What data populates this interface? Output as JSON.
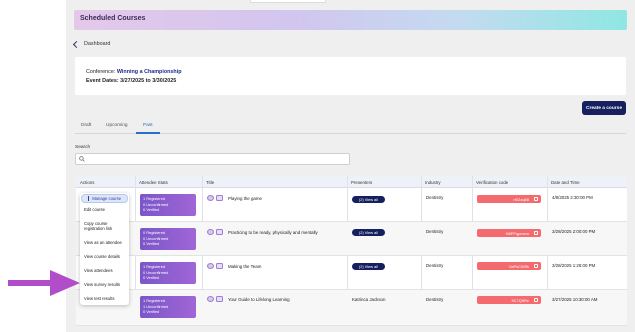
{
  "header": {
    "title": "Scheduled Courses"
  },
  "nav": {
    "back_label": "Dashboard"
  },
  "conference": {
    "conf_prefix": "Conference:",
    "conf_name": "Winning a Championship",
    "dates_label": "Event Dates: 3/27/2025 to 3/30/2025"
  },
  "actions": {
    "create_label": "Create a course"
  },
  "tabs": [
    {
      "label": "Draft"
    },
    {
      "label": "Upcoming"
    },
    {
      "label": "Past"
    }
  ],
  "active_tab": "Past",
  "search": {
    "label": "Search",
    "placeholder": ""
  },
  "table": {
    "columns": [
      "Actions",
      "Attendee Stats",
      "Title",
      "Presenters",
      "Industry",
      "Verification code",
      "Date and Time"
    ],
    "rows": [
      {
        "stats": [
          "1 Registered",
          "0 Unconfirmed",
          "0 Verified"
        ],
        "title": "Playing the game",
        "presenters": "(2) View all",
        "industry": "Dentistry",
        "code": "rt02zq88",
        "date": "4/8/2025 2:30:00 PM"
      },
      {
        "stats": [
          "0 Registered",
          "0 Unconfirmed",
          "0 Verified"
        ],
        "title": "Practicing to be ready, physically and mentally",
        "presenters": "(2) View all",
        "industry": "Dentistry",
        "code": "H8PFqpmcm",
        "date": "3/28/2025 2:00:00 PM"
      },
      {
        "stats": [
          "1 Registered",
          "0 Unconfirmed",
          "0 Verified"
        ],
        "title": "Making the Team",
        "presenters": "(2) View all",
        "industry": "Dentistry",
        "code": "VaPsCW9k",
        "date": "3/28/2025 1:25:00 PM"
      },
      {
        "stats": [
          "1 Registered",
          "1 Unconfirmed",
          "0 Verified"
        ],
        "title": "Your Guide to Lifelong Learning",
        "presenters": "Katrinca Jackson",
        "industry": "Dentistry",
        "code": "9C7Q9Rc",
        "date": "3/27/2025 10:30:00 AM"
      }
    ]
  },
  "action_menu": {
    "active_item": "Manage course",
    "items": [
      "Edit course",
      "Copy course registration link",
      "View as an attendee",
      "View course details",
      "View attendees",
      "View survey results",
      "View test results"
    ]
  },
  "colors": {
    "accent": "#16205e",
    "stats": "#8a5cd0",
    "code": "#f36b6f",
    "arrow": "#b14dc8"
  }
}
